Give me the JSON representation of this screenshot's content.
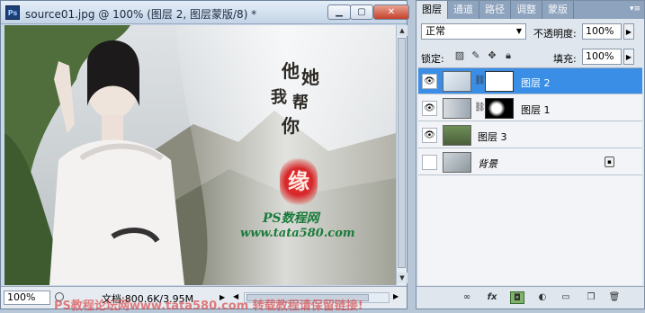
{
  "document": {
    "app_logo": "Ps",
    "title": "source01.jpg @ 100% (图层 2, 图层蒙版/8) *",
    "minimize_icon": "minimize-icon",
    "restore_icon": "restore-icon",
    "close_icon": "close-icon",
    "canvas": {
      "calligraphy": [
        "他",
        "她",
        "我",
        "帮",
        "你"
      ],
      "seal_text": "缘",
      "site_cn": "PS数程网",
      "site_url": "www.tata580.com"
    },
    "status": {
      "zoom": "100%",
      "doc_info": "文档:800.6K/3.95M"
    }
  },
  "layers_panel": {
    "tabs": [
      {
        "label": "图层",
        "active": true
      },
      {
        "label": "通道",
        "active": false
      },
      {
        "label": "路径",
        "active": false
      },
      {
        "label": "调整",
        "active": false
      },
      {
        "label": "蒙版",
        "active": false
      }
    ],
    "blend_mode": "正常",
    "opacity_label": "不透明度:",
    "opacity_value": "100%",
    "lock_label": "锁定:",
    "fill_label": "填充:",
    "fill_value": "100%",
    "layers": [
      {
        "name": "图层 2",
        "visible": true,
        "selected": true,
        "has_mask": true
      },
      {
        "name": "图层 1",
        "visible": true,
        "selected": false,
        "has_mask": true
      },
      {
        "name": "图层 3",
        "visible": true,
        "selected": false,
        "has_mask": false
      },
      {
        "name": "背景",
        "visible": false,
        "selected": false,
        "has_mask": false,
        "locked": true
      }
    ],
    "footer_icons": [
      "link-layers-icon",
      "fx-icon",
      "add-mask-icon",
      "adjustment-layer-icon",
      "new-group-icon",
      "new-layer-icon",
      "delete-icon"
    ]
  },
  "colors": {
    "selection": "#3a8ee6",
    "seal_red": "#d8262a",
    "site_green": "#1a7a3a"
  },
  "watermark": "PS教程论坛网www.tata580.com 转载教程请保留链接!"
}
